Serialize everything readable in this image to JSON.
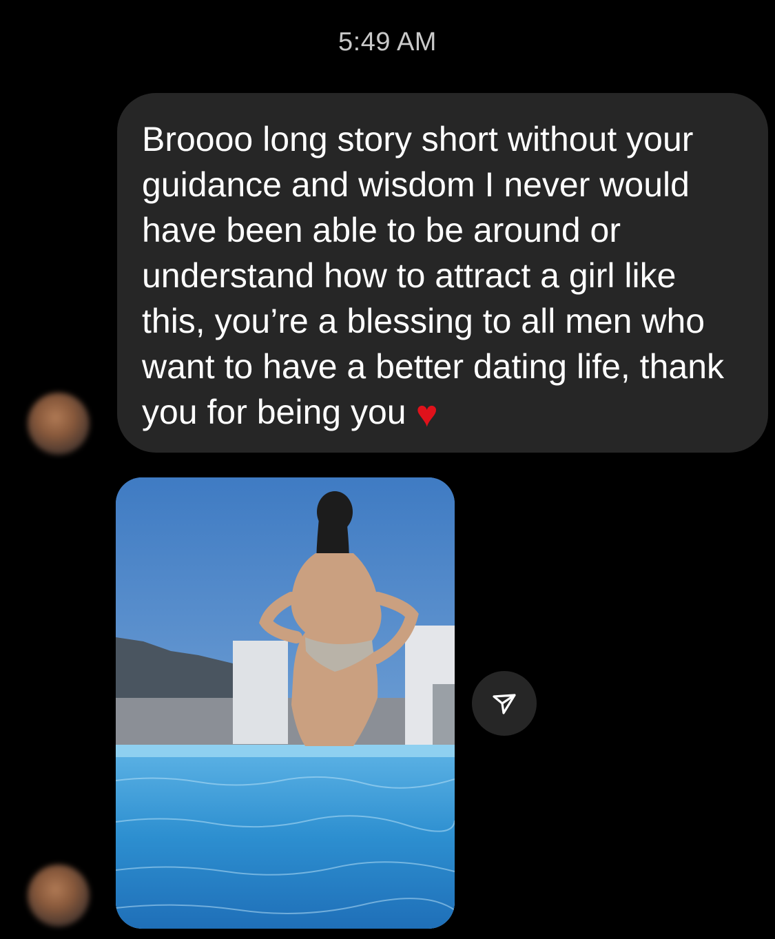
{
  "thread": {
    "timestamp": "5:49 AM"
  },
  "messages": [
    {
      "type": "text",
      "text": "Broooo long story short without your guidance and wisdom I never would have been able to be around or understand how to attract a girl like this, you’re a blessing to all men who want to have a better dating life, thank you for being you",
      "emoji": "♥"
    },
    {
      "type": "photo"
    }
  ],
  "icons": {
    "share": "paper-plane-icon"
  },
  "colors": {
    "background": "#000000",
    "bubble": "#262626",
    "timestamp": "#c9c9c9",
    "heart": "#e0121b"
  }
}
